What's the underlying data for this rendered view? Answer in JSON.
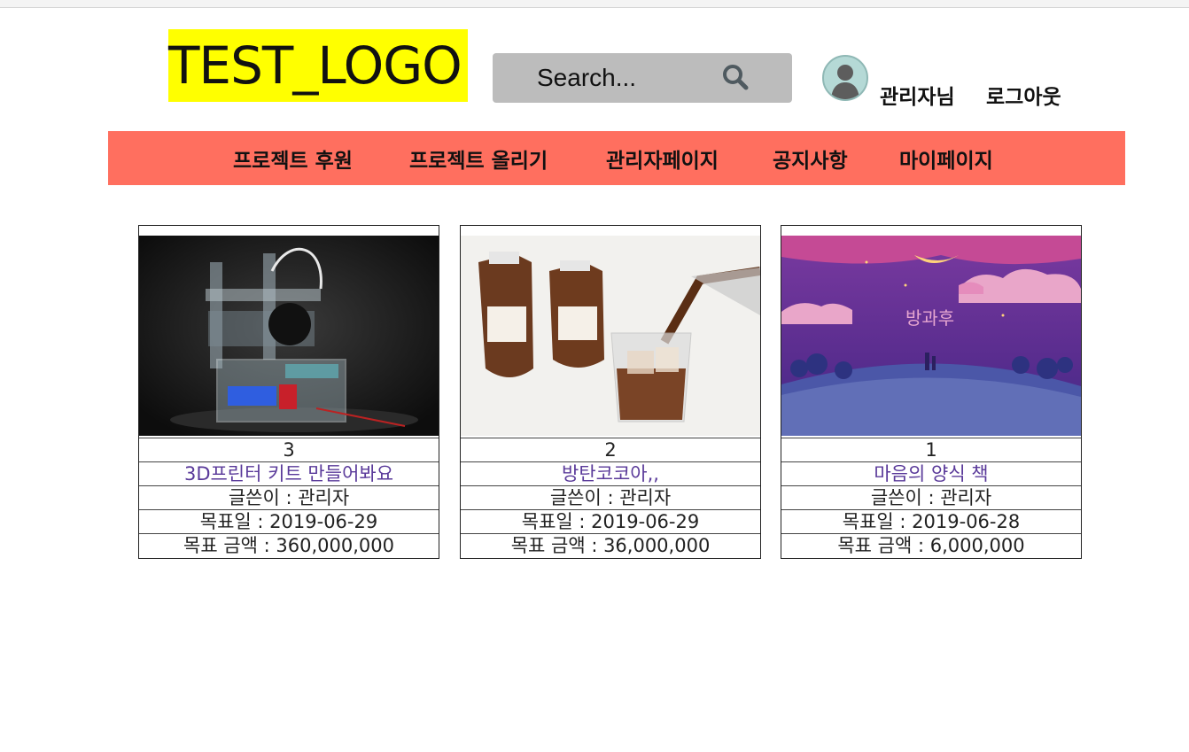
{
  "header": {
    "logo_text": "TEST_LOGO",
    "search_placeholder": "Search...",
    "user_label": "관리자님",
    "logout_label": "로그아웃"
  },
  "nav": {
    "items": [
      "프로젝트 후원",
      "프로젝트 올리기",
      "관리자페이지",
      "공지사항",
      "마이페이지"
    ]
  },
  "projects": [
    {
      "number": "3",
      "title": "3D프린터 키트 만들어봐요",
      "author": "글쓴이 : 관리자",
      "target_date": "목표일 : 2019-06-29",
      "target_amount": "목표 금액 : 360,000,000",
      "image": "3d-printer-kit-photo"
    },
    {
      "number": "2",
      "title": "방탄코코아,,",
      "author": "글쓴이 : 관리자",
      "target_date": "목표일 : 2019-06-29",
      "target_amount": "목표 금액 : 36,000,000",
      "image": "cocoa-drink-photo"
    },
    {
      "number": "1",
      "title": "마음의 양식 책",
      "author": "글쓴이 : 관리자",
      "target_date": "목표일 : 2019-06-28",
      "target_amount": "목표 금액 : 6,000,000",
      "image": "book-cover-illustration"
    }
  ],
  "images": {
    "book_cover_text": "방과후"
  },
  "colors": {
    "logo_bg": "#ffff00",
    "search_bg": "#bcbcbc",
    "nav_bg": "#ff6f5f",
    "link": "#5a3a9a"
  },
  "icons": {
    "search": "search-icon",
    "avatar": "user-avatar-icon"
  }
}
